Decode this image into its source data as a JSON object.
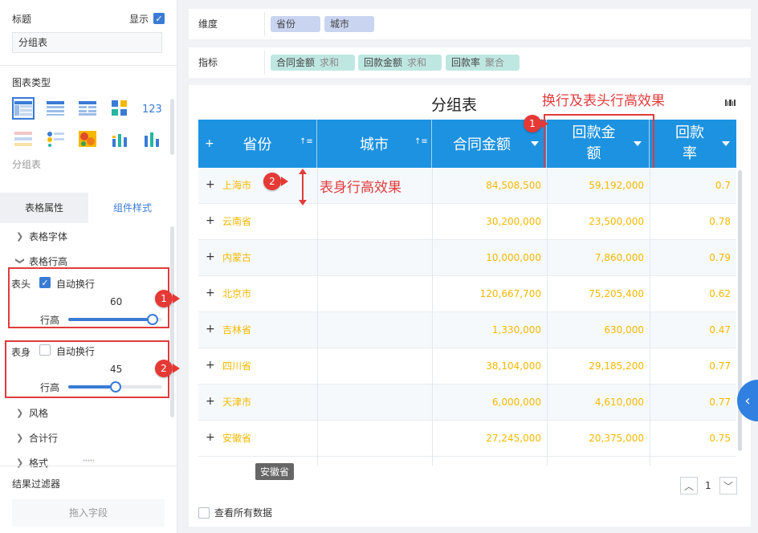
{
  "left_panel": {
    "title_label": "标题",
    "show_label": "显示",
    "title_value": "分组表",
    "chart_type_label": "图表类型",
    "chart_type_caption": "分组表",
    "tabs": [
      "表格属性",
      "组件样式"
    ],
    "sections": {
      "font": "表格字体",
      "row_height": "表格行高",
      "style": "风格",
      "total_row": "合计行",
      "format": "格式"
    },
    "header_setting": {
      "label": "表头",
      "auto_wrap": "自动换行",
      "auto_wrap_checked": true,
      "value": "60",
      "height_label": "行高",
      "level": 0.9
    },
    "body_setting": {
      "label": "表身",
      "auto_wrap": "自动换行",
      "auto_wrap_checked": false,
      "value": "45",
      "height_label": "行高",
      "level": 0.5
    },
    "filter_label": "结果过滤器",
    "drop_zone": "拖入字段"
  },
  "dimension": {
    "label": "维度",
    "pills": [
      "省份",
      "城市"
    ]
  },
  "measure": {
    "label": "指标",
    "pills": [
      {
        "name": "合同金额",
        "agg": "求和"
      },
      {
        "name": "回款金额",
        "agg": "求和"
      },
      {
        "name": "回款率",
        "agg": "聚合"
      }
    ]
  },
  "table": {
    "title": "分组表",
    "columns": [
      "省份",
      "城市",
      "合同金额",
      "回款金额",
      "回款率"
    ],
    "rows": [
      [
        "上海市",
        "",
        "84,508,500",
        "59,192,000",
        "0.7"
      ],
      [
        "云南省",
        "",
        "30,200,000",
        "23,500,000",
        "0.78"
      ],
      [
        "内蒙古",
        "",
        "10,000,000",
        "7,860,000",
        "0.79"
      ],
      [
        "北京市",
        "",
        "120,667,700",
        "75,205,400",
        "0.62"
      ],
      [
        "吉林省",
        "",
        "1,330,000",
        "630,000",
        "0.47"
      ],
      [
        "四川省",
        "",
        "38,104,000",
        "29,185,200",
        "0.77"
      ],
      [
        "天津市",
        "",
        "6,000,000",
        "4,610,000",
        "0.77"
      ],
      [
        "安徽省",
        "",
        "27,245,000",
        "20,375,000",
        "0.75"
      ]
    ],
    "tooltip": "安徽省",
    "page_number": "1",
    "view_all_label": "查看所有数据"
  },
  "annotations": {
    "header_effect": "换行及表头行高效果",
    "body_effect": "表身行高效果",
    "badge_1": "1",
    "badge_2": "2"
  },
  "colors": {
    "accent": "#3a7bd5",
    "header_bg": "#1d92e0",
    "cell_text": "#f5b800",
    "annotation": "#e03c3c"
  }
}
